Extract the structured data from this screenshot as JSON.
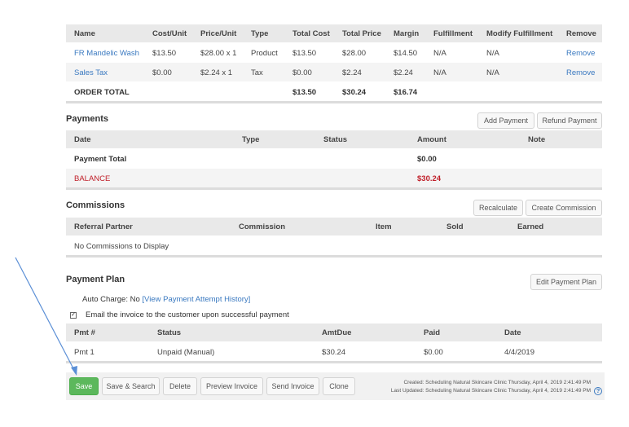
{
  "order_table": {
    "headers": [
      "Name",
      "Cost/Unit",
      "Price/Unit",
      "Type",
      "Total Cost",
      "Total Price",
      "Margin",
      "Fulfillment",
      "Modify Fulfillment",
      "Remove"
    ],
    "rows": [
      {
        "name": "FR Mandelic Wash",
        "cost_unit": "$13.50",
        "price_unit": "$28.00 x 1",
        "type": "Product",
        "total_cost": "$13.50",
        "total_price": "$28.00",
        "margin": "$14.50",
        "fulfillment": "N/A",
        "modify_fulfillment": "N/A",
        "remove": "Remove"
      },
      {
        "name": "Sales Tax",
        "cost_unit": "$0.00",
        "price_unit": "$2.24 x 1",
        "type": "Tax",
        "total_cost": "$0.00",
        "total_price": "$2.24",
        "margin": "$2.24",
        "fulfillment": "N/A",
        "modify_fulfillment": "N/A",
        "remove": "Remove"
      }
    ],
    "total": {
      "label": "ORDER TOTAL",
      "total_cost": "$13.50",
      "total_price": "$30.24",
      "margin": "$16.74"
    }
  },
  "payments": {
    "title": "Payments",
    "add_label": "Add Payment",
    "refund_label": "Refund Payment",
    "headers": [
      "Date",
      "Type",
      "Status",
      "Amount",
      "Note"
    ],
    "total_label": "Payment Total",
    "total_amount": "$0.00",
    "balance_label": "BALANCE",
    "balance_amount": "$30.24"
  },
  "commissions": {
    "title": "Commissions",
    "recalculate_label": "Recalculate",
    "create_label": "Create Commission",
    "headers": [
      "Referral Partner",
      "Commission",
      "Item",
      "Sold",
      "Earned"
    ],
    "empty_text": "No Commissions to Display"
  },
  "payment_plan": {
    "title": "Payment Plan",
    "edit_label": "Edit Payment Plan",
    "auto_charge_label": "Auto Charge:",
    "auto_charge_value": "No",
    "history_link": "[View Payment Attempt History]",
    "email_label": "Email the invoice to the customer upon successful payment",
    "email_checked": true,
    "headers": [
      "Pmt #",
      "Status",
      "AmtDue",
      "Paid",
      "Date"
    ],
    "rows": [
      {
        "pmt": "Pmt 1",
        "status": "Unpaid (Manual)",
        "amt_due": "$30.24",
        "paid": "$0.00",
        "date": "4/4/2019"
      }
    ]
  },
  "footer": {
    "save": "Save",
    "save_search": "Save & Search",
    "delete": "Delete",
    "preview": "Preview Invoice",
    "send": "Send Invoice",
    "clone": "Clone",
    "created": "Created:  Scheduling Natural Skincare Clinic Thursday, April 4, 2019 2:41:49 PM",
    "last_updated": "Last Updated:  Scheduling Natural Skincare Clinic Thursday, April 4, 2019 2:41:49 PM",
    "help_glyph": "?"
  },
  "colors": {
    "link": "#3a79c0",
    "balance": "#c0202a",
    "save_button": "#5cb85c",
    "annotation_arrow": "#5b8fd6"
  }
}
